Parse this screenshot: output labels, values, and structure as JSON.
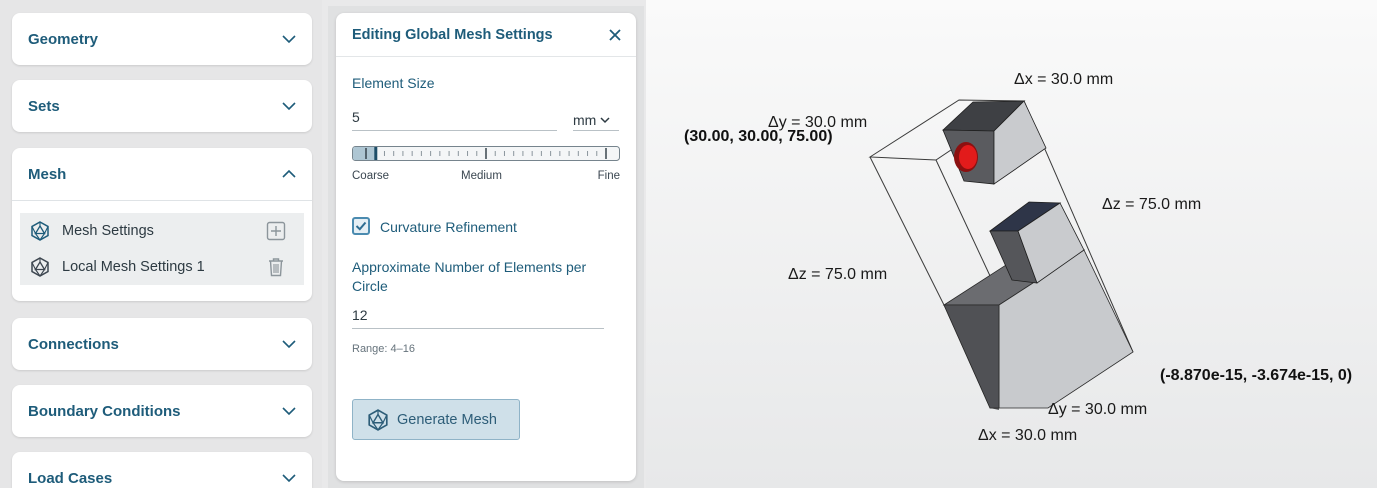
{
  "sidebar": {
    "sections": [
      {
        "label": "Geometry"
      },
      {
        "label": "Sets"
      },
      {
        "label": "Mesh"
      },
      {
        "label": "Connections"
      },
      {
        "label": "Boundary Conditions"
      },
      {
        "label": "Load Cases"
      }
    ],
    "mesh_items": [
      {
        "label": "Mesh Settings"
      },
      {
        "label": "Local Mesh Settings 1"
      }
    ]
  },
  "panel": {
    "title": "Editing Global Mesh Settings",
    "element_size_label": "Element Size",
    "element_size_value": "5",
    "unit": "mm",
    "slider_position": 0.05,
    "slider_labels": {
      "coarse": "Coarse",
      "medium": "Medium",
      "fine": "Fine"
    },
    "curvature_label": "Curvature Refinement",
    "curvature_checked": true,
    "elements_per_circle_label": "Approximate Number of Elements per Circle",
    "elements_per_circle_value": "12",
    "range_hint": "Range: 4–16",
    "generate_label": "Generate Mesh"
  },
  "viewport": {
    "dims": {
      "dx_top": "Δx = 30.0 mm",
      "dy_top": "Δy = 30.0 mm",
      "dz_right": "Δz = 75.0 mm",
      "dz_left": "Δz = 75.0 mm",
      "dy_bottom": "Δy = 30.0 mm",
      "dx_bottom": "Δx = 30.0 mm"
    },
    "coord_top": "(30.00, 30.00, 75.00)",
    "coord_bottom": "(-8.870e-15, -3.674e-15, 0)"
  },
  "colors": {
    "accent": "#1e5c7a",
    "button_bg": "#cfe0e9",
    "hole": "#e21b1b",
    "face_light": "#c9cbcf",
    "face_dark": "#4d4e52"
  }
}
